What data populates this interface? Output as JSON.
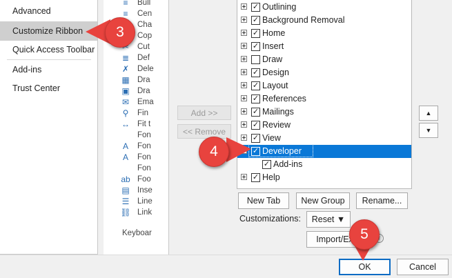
{
  "nav": {
    "items": [
      {
        "label": "Advanced"
      },
      {
        "label": "Customize Ribbon"
      },
      {
        "label": "Quick Access Toolbar"
      },
      {
        "label": "Add-ins"
      },
      {
        "label": "Trust Center"
      }
    ]
  },
  "commands": {
    "items": [
      {
        "icon": "bulleted-list-icon",
        "glyph": "≡",
        "label": "Bull"
      },
      {
        "icon": "center-icon",
        "glyph": "≡",
        "label": "Cen"
      },
      {
        "icon": "change-list-icon",
        "glyph": "≡",
        "label": "Cha"
      },
      {
        "icon": "copy-icon",
        "glyph": "❐",
        "label": "Cop"
      },
      {
        "icon": "cut-icon",
        "glyph": "✂",
        "label": "Cut"
      },
      {
        "icon": "define-icon",
        "glyph": "≣",
        "label": "Def"
      },
      {
        "icon": "delete-icon",
        "glyph": "✗",
        "label": "Dele"
      },
      {
        "icon": "draw-table-icon",
        "glyph": "▦",
        "label": "Dra"
      },
      {
        "icon": "draw-textbox-icon",
        "glyph": "▣",
        "label": "Dra"
      },
      {
        "icon": "email-icon",
        "glyph": "✉",
        "label": "Ema"
      },
      {
        "icon": "find-icon",
        "glyph": "⚲",
        "label": "Fin"
      },
      {
        "icon": "fit-icon",
        "glyph": "↔",
        "label": "Fit t"
      },
      {
        "icon": "font-icon",
        "glyph": "",
        "label": "Fon"
      },
      {
        "icon": "font-a-icon",
        "glyph": "A",
        "label": "Fon"
      },
      {
        "icon": "font-size-icon",
        "glyph": "A",
        "label": "Fon"
      },
      {
        "icon": "font-color-icon",
        "glyph": "",
        "label": "Fon"
      },
      {
        "icon": "footnote-icon",
        "glyph": "ab",
        "label": "Foo"
      },
      {
        "icon": "insert-icon",
        "glyph": "▤",
        "label": "Inse"
      },
      {
        "icon": "line-spacing-icon",
        "glyph": "☰",
        "label": "Line"
      },
      {
        "icon": "link-icon",
        "glyph": "⛓",
        "label": "Link"
      }
    ],
    "keyboard_label": "Keyboar"
  },
  "add_button": "Add >>",
  "remove_button": "<< Remove",
  "tree": {
    "rows": [
      {
        "label": "Outlining",
        "checked": true
      },
      {
        "label": "Background Removal",
        "checked": true
      },
      {
        "label": "Home",
        "checked": true
      },
      {
        "label": "Insert",
        "checked": true
      },
      {
        "label": "Draw",
        "checked": false
      },
      {
        "label": "Design",
        "checked": true
      },
      {
        "label": "Layout",
        "checked": true
      },
      {
        "label": "References",
        "checked": true
      },
      {
        "label": "Mailings",
        "checked": true
      },
      {
        "label": "Review",
        "checked": true
      },
      {
        "label": "View",
        "checked": true
      },
      {
        "label": "Developer",
        "checked": true,
        "selected": true
      },
      {
        "label": "Add-ins",
        "checked": true,
        "nested": true
      },
      {
        "label": "Help",
        "checked": true
      }
    ]
  },
  "move_up": "▲",
  "move_down": "▼",
  "buttons": {
    "new_tab": "New Tab",
    "new_group": "New Group",
    "rename": "Rename...",
    "customizations_label": "Customizations:",
    "reset": "Reset ▼",
    "import_export": "Import/Expo",
    "info": "i",
    "ok": "OK",
    "cancel": "Cancel"
  },
  "callouts": {
    "step3": "3",
    "step4": "4",
    "step5": "5"
  },
  "colors": {
    "selection": "#0a78d7",
    "callout": "#e8433e",
    "ok_border": "#0a6bc4"
  }
}
